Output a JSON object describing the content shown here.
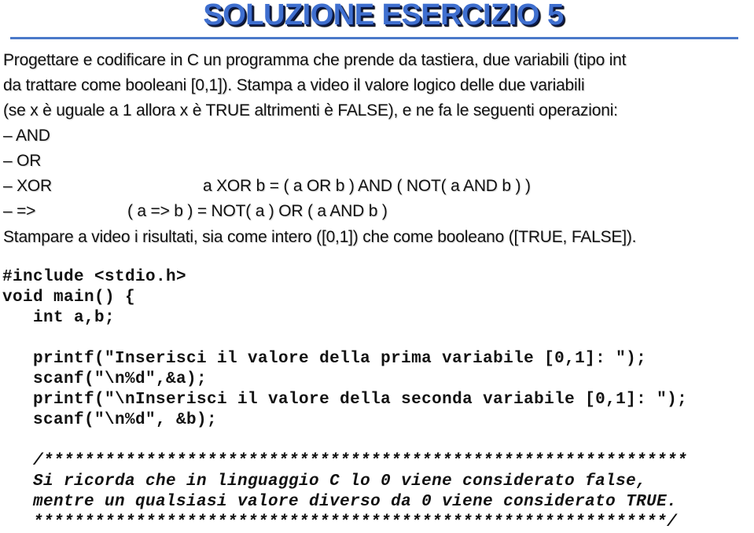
{
  "title": "SOLUZIONE ESERCIZIO 5",
  "colors": {
    "title": "#3f6fcf",
    "rule": "#4a79c9",
    "text": "#111111"
  },
  "description": {
    "lines": [
      "Progettare e codificare in C un programma che prende da tastiera, due variabili (tipo int",
      "da trattare come booleani [0,1]). Stampa a video il valore logico delle due variabili",
      "(se x è uguale a 1 allora x è TRUE altrimenti è FALSE), e ne fa le seguenti operazioni:"
    ]
  },
  "operations": [
    {
      "label": "– AND",
      "formula": ""
    },
    {
      "label": "– OR",
      "formula": ""
    },
    {
      "label": "– XOR",
      "formula": "a XOR b = ( a OR b ) AND ( NOT( a AND b ) )"
    },
    {
      "label": "– =>",
      "formula": "( a => b ) = NOT( a ) OR ( a AND b )"
    }
  ],
  "print_instruction": "Stampare a video i risultati, sia come intero ([0,1]) che come booleano ([TRUE, FALSE]).",
  "code": {
    "lines": [
      "#include <stdio.h>",
      "void main() {",
      "   int a,b;",
      "",
      "   printf(\"Inserisci il valore della prima variabile [0,1]: \");",
      "   scanf(\"\\n%d\",&a);",
      "   printf(\"\\nInserisci il valore della seconda variabile [0,1]: \");",
      "   scanf(\"\\n%d\", &b);",
      "",
      "   /***************************************************************",
      "   Si ricorda che in linguaggio C lo 0 viene considerato false,",
      "   mentre un qualsiasi valore diverso da 0 viene considerato TRUE.",
      "   **************************************************************/"
    ]
  }
}
